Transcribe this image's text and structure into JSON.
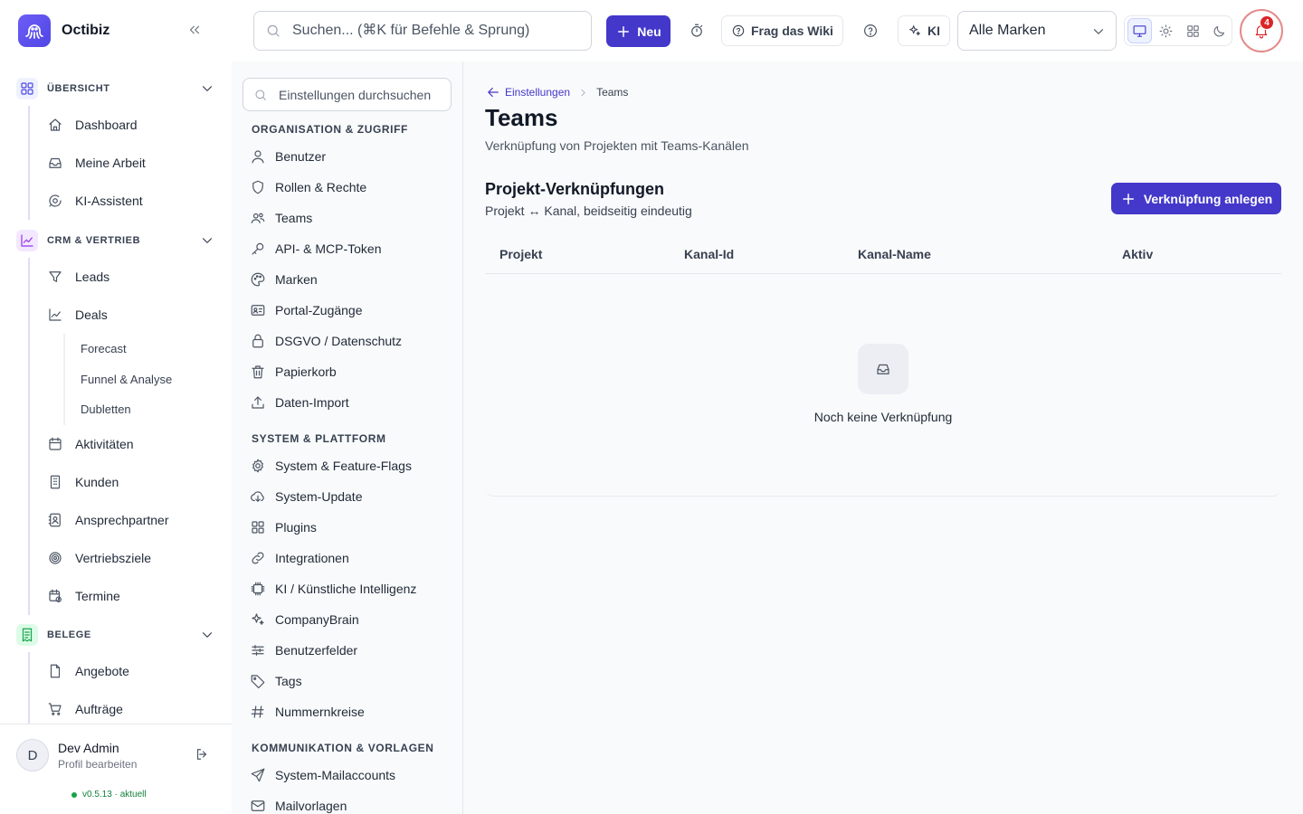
{
  "app": {
    "name": "Octibiz"
  },
  "sidebar": {
    "groups": [
      {
        "label": "ÜBERSICHT",
        "items": [
          "Dashboard",
          "Meine Arbeit",
          "KI-Assistent"
        ]
      },
      {
        "label": "CRM & VERTRIEB",
        "items": [
          "Leads",
          "Deals"
        ],
        "subitems": [
          "Forecast",
          "Funnel & Analyse",
          "Dubletten"
        ],
        "items_after": [
          "Aktivitäten",
          "Kunden",
          "Ansprechpartner",
          "Vertriebsziele",
          "Termine"
        ]
      },
      {
        "label": "BELEGE",
        "items": [
          "Angebote",
          "Aufträge"
        ]
      }
    ],
    "user": {
      "initial": "D",
      "name": "Dev Admin",
      "sub": "Profil bearbeiten"
    },
    "version": "v0.5.13 · aktuell"
  },
  "topbar": {
    "search_placeholder": "Suchen... (⌘K für Befehle & Sprung)",
    "new_label": "Neu",
    "wiki_label": "Frag das Wiki",
    "ai_label": "KI",
    "brand_select": "Alle Marken",
    "notifications": "4"
  },
  "settings": {
    "search_placeholder": "Einstellungen durchsuchen",
    "sections": [
      {
        "label": "ORGANISATION & ZUGRIFF",
        "items": [
          "Benutzer",
          "Rollen & Rechte",
          "Teams",
          "API- & MCP-Token",
          "Marken",
          "Portal-Zugänge",
          "DSGVO / Datenschutz",
          "Papierkorb",
          "Daten-Import"
        ]
      },
      {
        "label": "SYSTEM & PLATTFORM",
        "items": [
          "System & Feature-Flags",
          "System-Update",
          "Plugins",
          "Integrationen",
          "KI / Künstliche Intelligenz",
          "CompanyBrain",
          "Benutzerfelder",
          "Tags",
          "Nummernkreise"
        ]
      },
      {
        "label": "KOMMUNIKATION & VORLAGEN",
        "items": [
          "System-Mailaccounts",
          "Mailvorlagen"
        ]
      }
    ]
  },
  "main": {
    "breadcrumb_parent": "Einstellungen",
    "breadcrumb_current": "Teams",
    "title": "Teams",
    "subtitle": "Verknüpfung von Projekten mit Teams-Kanälen",
    "card_title": "Projekt-Verknüpfungen",
    "card_subtitle": "Projekt ↔ Kanal, beidseitig eindeutig",
    "add_label": "Verknüpfung anlegen",
    "columns": [
      "Projekt",
      "Kanal-Id",
      "Kanal-Name",
      "Aktiv"
    ],
    "empty_text": "Noch keine Verknüpfung"
  },
  "colors": {
    "accent": "#4338ca",
    "danger": "#dc2626",
    "success": "#16a34a"
  }
}
